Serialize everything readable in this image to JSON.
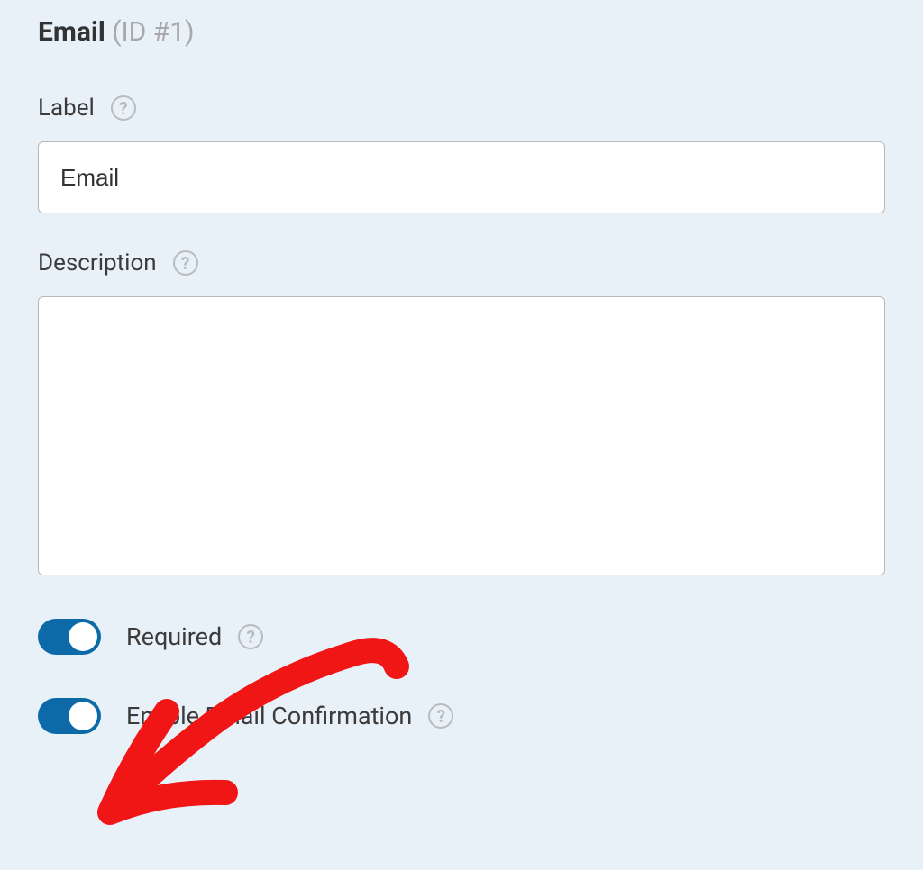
{
  "header": {
    "title": "Email",
    "id_text": "(ID #1)"
  },
  "fields": {
    "label": {
      "caption": "Label",
      "value": "Email"
    },
    "description": {
      "caption": "Description",
      "value": ""
    }
  },
  "toggles": {
    "required": {
      "label": "Required",
      "on": true
    },
    "email_confirmation": {
      "label": "Enable Email Confirmation",
      "on": true
    }
  },
  "help_glyph": "?"
}
